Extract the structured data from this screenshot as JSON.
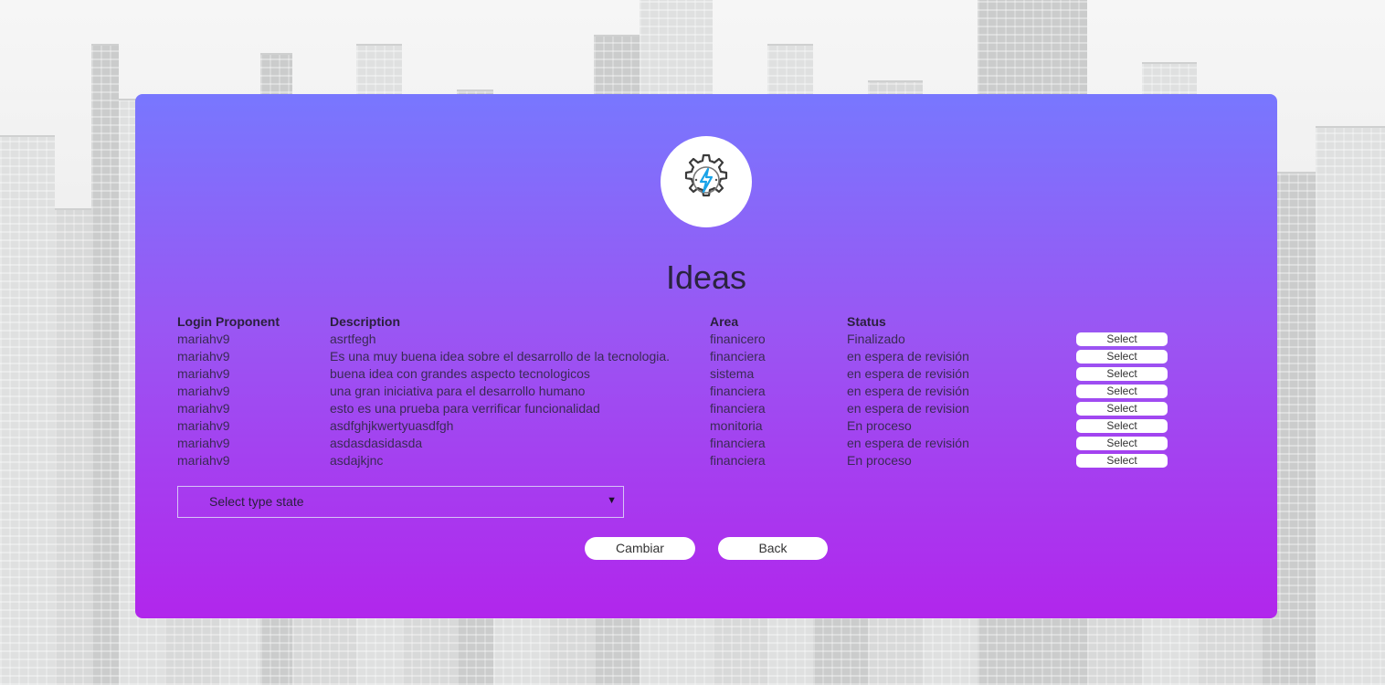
{
  "page": {
    "title": "Ideas",
    "icon": "gear-lightning-icon"
  },
  "table": {
    "headers": [
      "Login Proponent",
      "Description",
      "Area",
      "Status"
    ],
    "select_label": "Select",
    "rows": [
      {
        "login": "mariahv9",
        "description": "asrtfegh",
        "area": "finanicero",
        "status": "Finalizado"
      },
      {
        "login": "mariahv9",
        "description": "Es una muy buena idea sobre el desarrollo de la tecnologia.",
        "area": "financiera",
        "status": "en espera de revisión"
      },
      {
        "login": "mariahv9",
        "description": "buena idea con grandes aspecto tecnologicos",
        "area": "sistema",
        "status": "en espera de revisión"
      },
      {
        "login": "mariahv9",
        "description": "una gran iniciativa para el desarrollo humano",
        "area": "financiera",
        "status": "en espera de revisión"
      },
      {
        "login": "mariahv9",
        "description": "esto es una prueba para verrificar funcionalidad",
        "area": "financiera",
        "status": "en espera de revision"
      },
      {
        "login": "mariahv9",
        "description": "asdfghjkwertyuasdfgh",
        "area": "monitoria",
        "status": "En proceso"
      },
      {
        "login": "mariahv9",
        "description": "asdasdasidasda",
        "area": "financiera",
        "status": "en espera de revisión"
      },
      {
        "login": "mariahv9",
        "description": "asdajkjnc",
        "area": "financiera",
        "status": "En proceso"
      }
    ]
  },
  "state_select": {
    "selected": "Select type state"
  },
  "actions": {
    "cambiar_label": "Cambiar",
    "back_label": "Back"
  },
  "colors": {
    "card_top": "#7877fe",
    "card_bottom": "#b126ec",
    "icon_accent": "#1aa3e8"
  }
}
